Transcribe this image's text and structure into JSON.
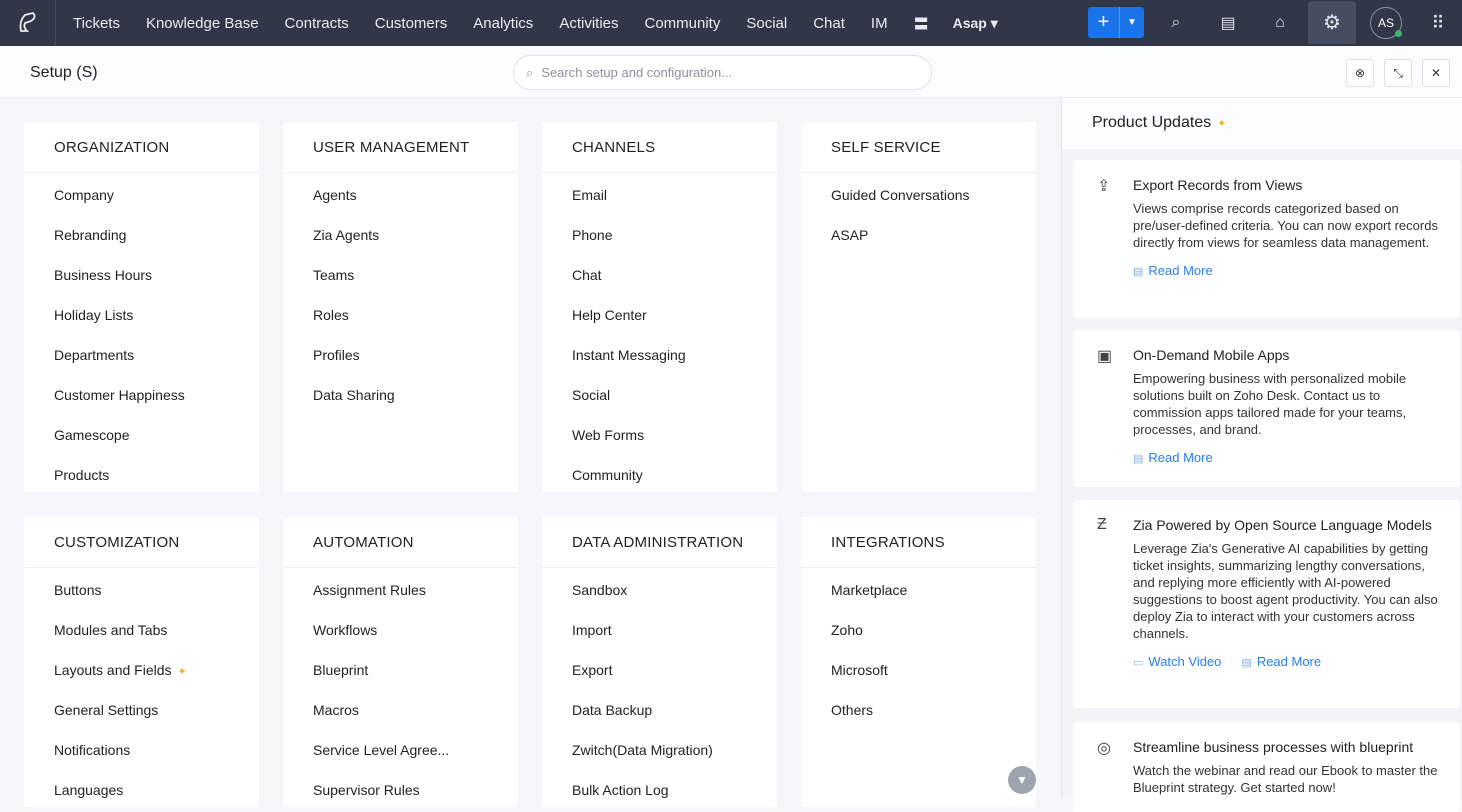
{
  "topbar": {
    "nav": [
      "Tickets",
      "Knowledge Base",
      "Contracts",
      "Customers",
      "Analytics",
      "Activities",
      "Community",
      "Social",
      "Chat",
      "IM"
    ],
    "workspace": "Asap",
    "avatar": "AS"
  },
  "setup": {
    "title": "Setup (S)",
    "search_placeholder": "Search setup and configuration..."
  },
  "sections": [
    {
      "title": "ORGANIZATION",
      "items": [
        "Company",
        "Rebranding",
        "Business Hours",
        "Holiday Lists",
        "Departments",
        "Customer Happiness",
        "Gamescope",
        "Products"
      ]
    },
    {
      "title": "USER MANAGEMENT",
      "items": [
        "Agents",
        "Zia Agents",
        "Teams",
        "Roles",
        "Profiles",
        "Data Sharing"
      ]
    },
    {
      "title": "CHANNELS",
      "items": [
        "Email",
        "Phone",
        "Chat",
        "Help Center",
        "Instant Messaging",
        "Social",
        "Web Forms",
        "Community"
      ]
    },
    {
      "title": "SELF SERVICE",
      "items": [
        "Guided Conversations",
        "ASAP"
      ]
    },
    {
      "title": "CUSTOMIZATION",
      "items": [
        "Buttons",
        "Modules and Tabs",
        "Layouts and Fields",
        "General Settings",
        "Notifications",
        "Languages"
      ]
    },
    {
      "title": "AUTOMATION",
      "items": [
        "Assignment Rules",
        "Workflows",
        "Blueprint",
        "Macros",
        "Service Level Agree...",
        "Supervisor Rules"
      ]
    },
    {
      "title": "DATA ADMINISTRATION",
      "items": [
        "Sandbox",
        "Import",
        "Export",
        "Data Backup",
        "Zwitch(Data Migration)",
        "Bulk Action Log"
      ]
    },
    {
      "title": "INTEGRATIONS",
      "items": [
        "Marketplace",
        "Zoho",
        "Microsoft",
        "Others"
      ]
    }
  ],
  "updates": {
    "title": "Product Updates",
    "items": [
      {
        "icon": "upload-icon",
        "title": "Export Records from Views",
        "body": "Views comprise records categorized based on pre/user-defined criteria. You can now export records directly from views for seamless data management.",
        "links": [
          "Read More"
        ]
      },
      {
        "icon": "mobile-app-icon",
        "title": "On-Demand Mobile Apps",
        "body": "Empowering business with personalized mobile solutions built on Zoho Desk. Contact us to commission apps tailored made for your teams, processes, and brand.",
        "links": [
          "Read More"
        ]
      },
      {
        "icon": "zia-icon",
        "title": "Zia Powered by Open Source Language Models",
        "body": "Leverage Zia's Generative AI capabilities by getting ticket insights, summarizing lengthy conversations, and replying more efficiently with AI-powered suggestions to boost agent productivity. You can also deploy Zia to interact with your customers across channels.",
        "links": [
          "Watch Video",
          "Read More"
        ]
      },
      {
        "icon": "blueprint-icon",
        "title": "Streamline business processes with blueprint",
        "body": "Watch the webinar and read our Ebook to master the Blueprint strategy. Get started now!",
        "links": []
      }
    ]
  }
}
